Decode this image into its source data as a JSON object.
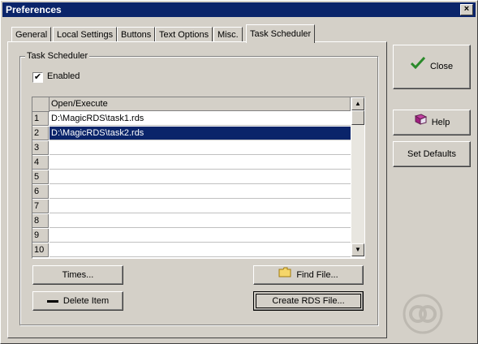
{
  "window": {
    "title": "Preferences",
    "close_glyph": "×"
  },
  "tabs": [
    "General",
    "Local Settings",
    "Buttons",
    "Text Options",
    "Misc.",
    "Task Scheduler"
  ],
  "active_tab": "Task Scheduler",
  "group": {
    "label": "Task Scheduler"
  },
  "enabled_checkbox": {
    "label": "Enabled",
    "checked": true,
    "check_glyph": "✔"
  },
  "grid": {
    "column_header": "Open/Execute",
    "rows": [
      {
        "num": "1",
        "value": "D:\\MagicRDS\\task1.rds"
      },
      {
        "num": "2",
        "value": "D:\\MagicRDS\\task2.rds"
      },
      {
        "num": "3",
        "value": ""
      },
      {
        "num": "4",
        "value": ""
      },
      {
        "num": "5",
        "value": ""
      },
      {
        "num": "6",
        "value": ""
      },
      {
        "num": "7",
        "value": ""
      },
      {
        "num": "8",
        "value": ""
      },
      {
        "num": "9",
        "value": ""
      },
      {
        "num": "10",
        "value": ""
      }
    ],
    "selected_row": "2",
    "scroll_up_glyph": "▲",
    "scroll_down_glyph": "▼"
  },
  "buttons": {
    "times": "Times...",
    "delete_item": "Delete Item",
    "find_file": "Find File...",
    "create_rds_file": "Create RDS File...",
    "close": "Close",
    "help": "Help",
    "set_defaults": "Set Defaults"
  },
  "colors": {
    "titlebar": "#0a246a",
    "face": "#d4d0c8",
    "selection": "#0a246a",
    "check_green": "#2a8a2a"
  },
  "icons": {
    "close_button_icon": "checkmark-icon",
    "help_button_icon": "book-icon",
    "find_file_icon": "folder-icon",
    "delete_icon": "minus-icon",
    "logo": "logo-icon"
  }
}
